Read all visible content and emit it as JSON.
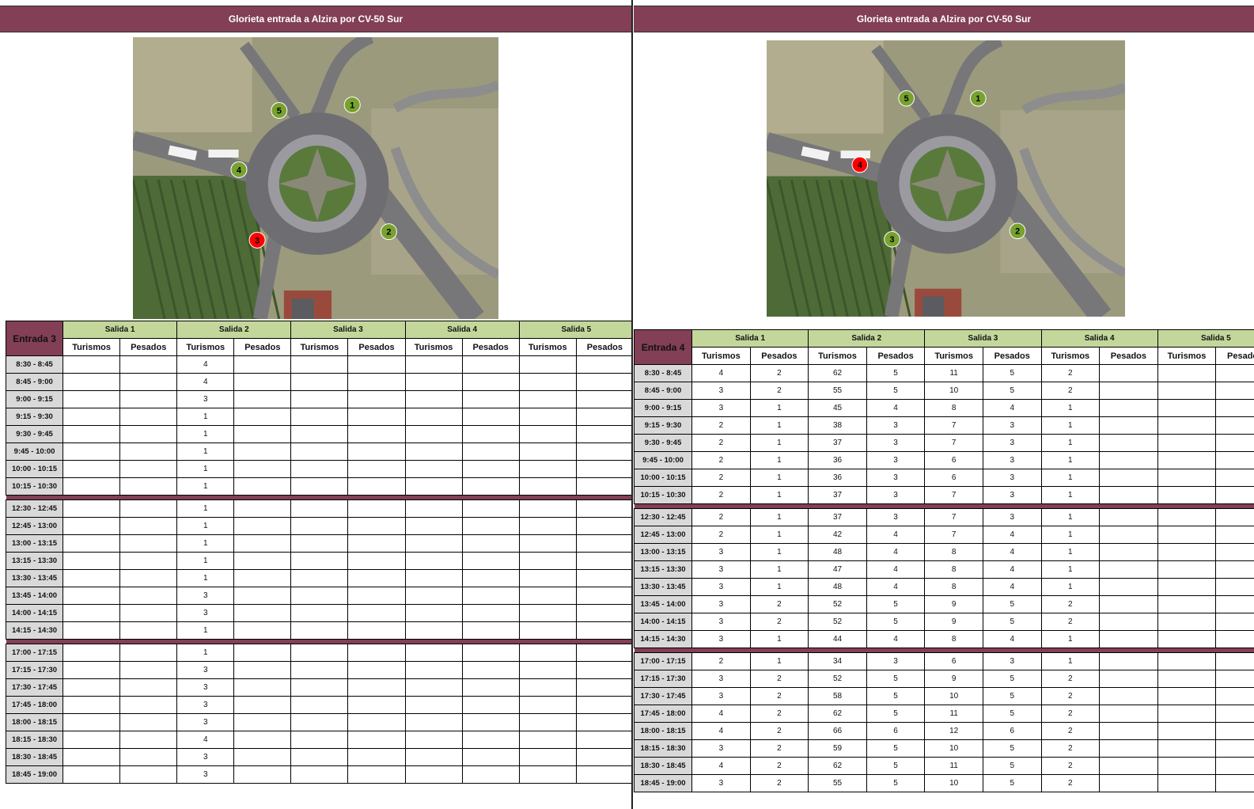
{
  "left": {
    "title": "Glorieta entrada a Alzira por CV-50 Sur",
    "entrada": "Entrada 3",
    "salidas": [
      "Salida 1",
      "Salida 2",
      "Salida 3",
      "Salida 4",
      "Salida 5"
    ],
    "sub": [
      "Turismos",
      "Pesados"
    ],
    "map_markers": [
      {
        "label": "1",
        "color": "#78a22f"
      },
      {
        "label": "2",
        "color": "#78a22f"
      },
      {
        "label": "3",
        "color": "#ff0000"
      },
      {
        "label": "4",
        "color": "#78a22f"
      },
      {
        "label": "5",
        "color": "#78a22f"
      }
    ],
    "groups": [
      [
        [
          "8:30 - 8:45",
          [
            "",
            "",
            "4",
            "",
            "",
            "",
            "",
            "",
            "",
            ""
          ]
        ],
        [
          "8:45 - 9:00",
          [
            "",
            "",
            "4",
            "",
            "",
            "",
            "",
            "",
            "",
            ""
          ]
        ],
        [
          "9:00 - 9:15",
          [
            "",
            "",
            "3",
            "",
            "",
            "",
            "",
            "",
            "",
            ""
          ]
        ],
        [
          "9:15 - 9:30",
          [
            "",
            "",
            "1",
            "",
            "",
            "",
            "",
            "",
            "",
            ""
          ]
        ],
        [
          "9:30 - 9:45",
          [
            "",
            "",
            "1",
            "",
            "",
            "",
            "",
            "",
            "",
            ""
          ]
        ],
        [
          "9:45 - 10:00",
          [
            "",
            "",
            "1",
            "",
            "",
            "",
            "",
            "",
            "",
            ""
          ]
        ],
        [
          "10:00 - 10:15",
          [
            "",
            "",
            "1",
            "",
            "",
            "",
            "",
            "",
            "",
            ""
          ]
        ],
        [
          "10:15 - 10:30",
          [
            "",
            "",
            "1",
            "",
            "",
            "",
            "",
            "",
            "",
            ""
          ]
        ]
      ],
      [
        [
          "12:30 - 12:45",
          [
            "",
            "",
            "1",
            "",
            "",
            "",
            "",
            "",
            "",
            ""
          ]
        ],
        [
          "12:45 - 13:00",
          [
            "",
            "",
            "1",
            "",
            "",
            "",
            "",
            "",
            "",
            ""
          ]
        ],
        [
          "13:00 - 13:15",
          [
            "",
            "",
            "1",
            "",
            "",
            "",
            "",
            "",
            "",
            ""
          ]
        ],
        [
          "13:15 - 13:30",
          [
            "",
            "",
            "1",
            "",
            "",
            "",
            "",
            "",
            "",
            ""
          ]
        ],
        [
          "13:30 - 13:45",
          [
            "",
            "",
            "1",
            "",
            "",
            "",
            "",
            "",
            "",
            ""
          ]
        ],
        [
          "13:45 - 14:00",
          [
            "",
            "",
            "3",
            "",
            "",
            "",
            "",
            "",
            "",
            ""
          ]
        ],
        [
          "14:00 - 14:15",
          [
            "",
            "",
            "3",
            "",
            "",
            "",
            "",
            "",
            "",
            ""
          ]
        ],
        [
          "14:15 - 14:30",
          [
            "",
            "",
            "1",
            "",
            "",
            "",
            "",
            "",
            "",
            ""
          ]
        ]
      ],
      [
        [
          "17:00 - 17:15",
          [
            "",
            "",
            "1",
            "",
            "",
            "",
            "",
            "",
            "",
            ""
          ]
        ],
        [
          "17:15 - 17:30",
          [
            "",
            "",
            "3",
            "",
            "",
            "",
            "",
            "",
            "",
            ""
          ]
        ],
        [
          "17:30 - 17:45",
          [
            "",
            "",
            "3",
            "",
            "",
            "",
            "",
            "",
            "",
            ""
          ]
        ],
        [
          "17:45 - 18:00",
          [
            "",
            "",
            "3",
            "",
            "",
            "",
            "",
            "",
            "",
            ""
          ]
        ],
        [
          "18:00 - 18:15",
          [
            "",
            "",
            "3",
            "",
            "",
            "",
            "",
            "",
            "",
            ""
          ]
        ],
        [
          "18:15 - 18:30",
          [
            "",
            "",
            "4",
            "",
            "",
            "",
            "",
            "",
            "",
            ""
          ]
        ],
        [
          "18:30 - 18:45",
          [
            "",
            "",
            "3",
            "",
            "",
            "",
            "",
            "",
            "",
            ""
          ]
        ],
        [
          "18:45 - 19:00",
          [
            "",
            "",
            "3",
            "",
            "",
            "",
            "",
            "",
            "",
            ""
          ]
        ]
      ]
    ]
  },
  "right": {
    "title": "Glorieta entrada a Alzira por CV-50 Sur",
    "entrada": "Entrada 4",
    "salidas": [
      "Salida 1",
      "Salida 2",
      "Salida 3",
      "Salida 4",
      "Salida 5"
    ],
    "sub": [
      "Turismos",
      "Pesados"
    ],
    "map_markers": [
      {
        "label": "1",
        "color": "#78a22f"
      },
      {
        "label": "2",
        "color": "#78a22f"
      },
      {
        "label": "3",
        "color": "#78a22f"
      },
      {
        "label": "4",
        "color": "#ff0000"
      },
      {
        "label": "5",
        "color": "#78a22f"
      }
    ],
    "groups": [
      [
        [
          "8:30 - 8:45",
          [
            "4",
            "2",
            "62",
            "5",
            "11",
            "5",
            "2",
            "",
            "",
            ""
          ]
        ],
        [
          "8:45 - 9:00",
          [
            "3",
            "2",
            "55",
            "5",
            "10",
            "5",
            "2",
            "",
            "",
            ""
          ]
        ],
        [
          "9:00 - 9:15",
          [
            "3",
            "1",
            "45",
            "4",
            "8",
            "4",
            "1",
            "",
            "",
            ""
          ]
        ],
        [
          "9:15 - 9:30",
          [
            "2",
            "1",
            "38",
            "3",
            "7",
            "3",
            "1",
            "",
            "",
            ""
          ]
        ],
        [
          "9:30 - 9:45",
          [
            "2",
            "1",
            "37",
            "3",
            "7",
            "3",
            "1",
            "",
            "",
            ""
          ]
        ],
        [
          "9:45 - 10:00",
          [
            "2",
            "1",
            "36",
            "3",
            "6",
            "3",
            "1",
            "",
            "",
            ""
          ]
        ],
        [
          "10:00 - 10:15",
          [
            "2",
            "1",
            "36",
            "3",
            "6",
            "3",
            "1",
            "",
            "",
            ""
          ]
        ],
        [
          "10:15 - 10:30",
          [
            "2",
            "1",
            "37",
            "3",
            "7",
            "3",
            "1",
            "",
            "",
            ""
          ]
        ]
      ],
      [
        [
          "12:30 - 12:45",
          [
            "2",
            "1",
            "37",
            "3",
            "7",
            "3",
            "1",
            "",
            "",
            ""
          ]
        ],
        [
          "12:45 - 13:00",
          [
            "2",
            "1",
            "42",
            "4",
            "7",
            "4",
            "1",
            "",
            "",
            ""
          ]
        ],
        [
          "13:00 - 13:15",
          [
            "3",
            "1",
            "48",
            "4",
            "8",
            "4",
            "1",
            "",
            "",
            ""
          ]
        ],
        [
          "13:15 - 13:30",
          [
            "3",
            "1",
            "47",
            "4",
            "8",
            "4",
            "1",
            "",
            "",
            ""
          ]
        ],
        [
          "13:30 - 13:45",
          [
            "3",
            "1",
            "48",
            "4",
            "8",
            "4",
            "1",
            "",
            "",
            ""
          ]
        ],
        [
          "13:45 - 14:00",
          [
            "3",
            "2",
            "52",
            "5",
            "9",
            "5",
            "2",
            "",
            "",
            ""
          ]
        ],
        [
          "14:00 - 14:15",
          [
            "3",
            "2",
            "52",
            "5",
            "9",
            "5",
            "2",
            "",
            "",
            ""
          ]
        ],
        [
          "14:15 - 14:30",
          [
            "3",
            "1",
            "44",
            "4",
            "8",
            "4",
            "1",
            "",
            "",
            ""
          ]
        ]
      ],
      [
        [
          "17:00 - 17:15",
          [
            "2",
            "1",
            "34",
            "3",
            "6",
            "3",
            "1",
            "",
            "",
            ""
          ]
        ],
        [
          "17:15 - 17:30",
          [
            "3",
            "2",
            "52",
            "5",
            "9",
            "5",
            "2",
            "",
            "",
            ""
          ]
        ],
        [
          "17:30 - 17:45",
          [
            "3",
            "2",
            "58",
            "5",
            "10",
            "5",
            "2",
            "",
            "",
            ""
          ]
        ],
        [
          "17:45 - 18:00",
          [
            "4",
            "2",
            "62",
            "5",
            "11",
            "5",
            "2",
            "",
            "",
            ""
          ]
        ],
        [
          "18:00 - 18:15",
          [
            "4",
            "2",
            "66",
            "6",
            "12",
            "6",
            "2",
            "",
            "",
            ""
          ]
        ],
        [
          "18:15 - 18:30",
          [
            "3",
            "2",
            "59",
            "5",
            "10",
            "5",
            "2",
            "",
            "",
            ""
          ]
        ],
        [
          "18:30 - 18:45",
          [
            "4",
            "2",
            "62",
            "5",
            "11",
            "5",
            "2",
            "",
            "",
            ""
          ]
        ],
        [
          "18:45 - 19:00",
          [
            "3",
            "2",
            "55",
            "5",
            "10",
            "5",
            "2",
            "",
            "",
            ""
          ]
        ]
      ]
    ]
  }
}
